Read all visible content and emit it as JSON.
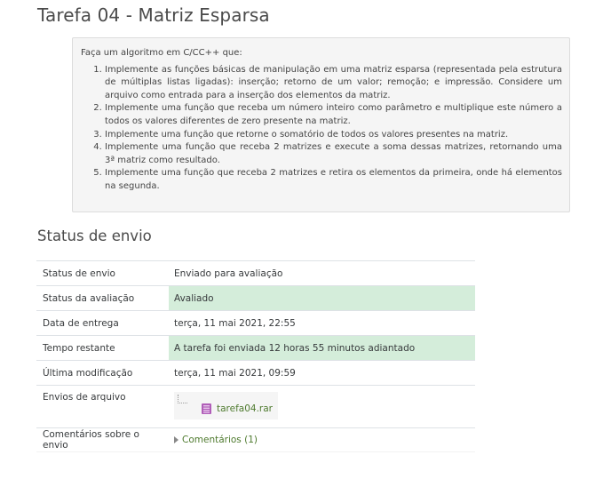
{
  "page": {
    "title": "Tarefa 04 - Matriz Esparsa"
  },
  "intro": {
    "lead": "Faça um algoritmo em C/CC++ que:",
    "items": [
      "Implemente as funções básicas de manipulação em uma matriz esparsa (representada pela estrutura de múltiplas listas ligadas): inserção; retorno de um valor; remoção; e impressão. Considere um arquivo como entrada para a inserção dos elementos da matriz.",
      "Implemente uma função que receba um número inteiro como parâmetro e multiplique este número a todos os valores diferentes de zero presente na matriz.",
      "Implemente uma função que retorne o somatório de todos os valores presentes na matriz.",
      "Implemente uma função que receba 2 matrizes e execute a soma dessas matrizes, retornando uma 3ª matriz como resultado.",
      "Implemente uma função que receba 2 matrizes e retira os elementos da primeira, onde há elementos na segunda."
    ]
  },
  "submission": {
    "title": "Status de envio",
    "rows": [
      {
        "label": "Status de envio",
        "value": "Enviado para avaliação"
      },
      {
        "label": "Status da avaliação",
        "value": "Avaliado"
      },
      {
        "label": "Data de entrega",
        "value": "terça, 11 mai 2021, 22:55"
      },
      {
        "label": "Tempo restante",
        "value": "A tarefa foi enviada 12 horas 55 minutos adiantado"
      },
      {
        "label": "Última modificação",
        "value": "terça, 11 mai 2021, 09:59"
      },
      {
        "label": "Envios de arquivo",
        "file": "tarefa04.rar"
      },
      {
        "label": "Comentários sobre o envio",
        "link": "Comentários (1)"
      }
    ]
  },
  "colors": {
    "success_bg": "#d4edda",
    "link": "#4e7a2e",
    "rar_icon": "#b05eb8"
  },
  "icons": {
    "file": "rar-file-icon",
    "expand": "caret-right-icon"
  }
}
